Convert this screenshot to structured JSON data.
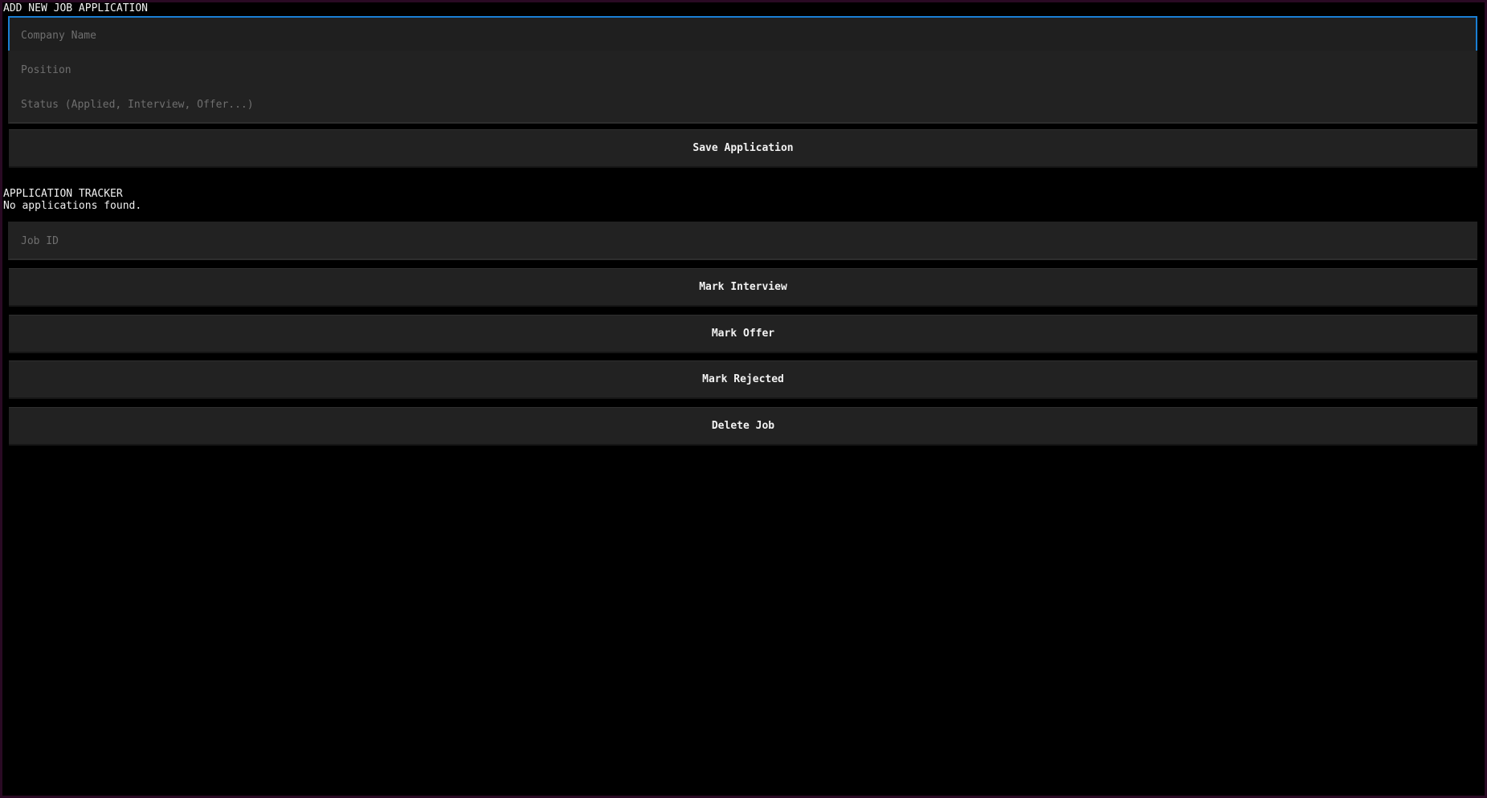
{
  "add_form": {
    "title": "ADD NEW JOB APPLICATION",
    "company_placeholder": "Company Name",
    "position_placeholder": "Position",
    "status_placeholder": "Status (Applied, Interview, Offer...)",
    "save_label": "Save Application"
  },
  "tracker": {
    "title": "APPLICATION TRACKER",
    "empty_message": "No applications found.",
    "job_id_placeholder": "Job ID",
    "mark_interview_label": "Mark Interview",
    "mark_offer_label": "Mark Offer",
    "mark_rejected_label": "Mark Rejected",
    "delete_label": "Delete Job"
  },
  "colors": {
    "background": "#000000",
    "field_background": "#222222",
    "focus_border": "#1a7fd4",
    "window_border": "#2a0a24"
  }
}
